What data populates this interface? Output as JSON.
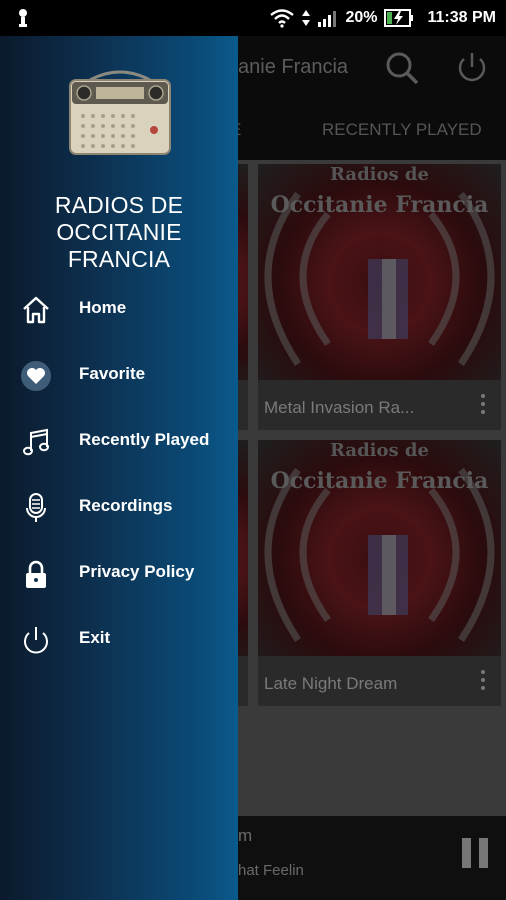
{
  "status_bar": {
    "battery_percent": "20%",
    "time": "11:38 PM"
  },
  "app": {
    "title": "anie Francia",
    "tabs": [
      {
        "label": "E"
      },
      {
        "label": "RECENTLY PLAYED"
      }
    ],
    "cards": [
      {
        "art_line1": "Radios de",
        "art_line2": "Occitanie Francia",
        "caption": "Metal Invasion Ra..."
      },
      {
        "art_line1": "Radios de",
        "art_line2": "Occitanie Francia",
        "caption": "Late Night Dream"
      }
    ],
    "player": {
      "title": "m",
      "caption": "hat Feelin"
    }
  },
  "drawer": {
    "app_name_line1": "RADIOS DE",
    "app_name_line2": "OCCITANIE",
    "app_name_line3": "FRANCIA",
    "items": [
      {
        "label": "Home",
        "icon": "home-icon"
      },
      {
        "label": "Favorite",
        "icon": "heart-icon"
      },
      {
        "label": "Recently Played",
        "icon": "music-note-icon"
      },
      {
        "label": "Recordings",
        "icon": "microphone-icon"
      },
      {
        "label": "Privacy Policy",
        "icon": "lock-icon"
      },
      {
        "label": "Exit",
        "icon": "power-icon"
      }
    ]
  },
  "colors": {
    "drawer_dark": "#0b1a2c",
    "drawer_light": "#0a5a8c",
    "status_bar": "#000000"
  }
}
